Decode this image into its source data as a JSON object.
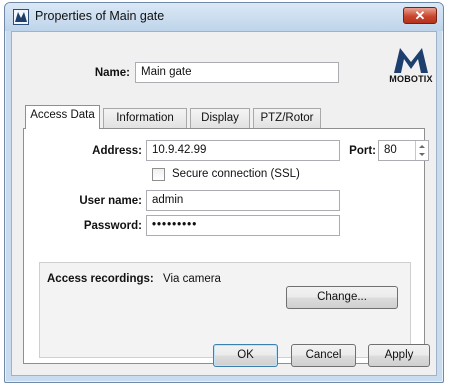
{
  "window": {
    "title": "Properties of Main gate",
    "close_label": "✕"
  },
  "header": {
    "name_label": "Name:",
    "name_value": "Main gate",
    "logo_text": "MOBOTIX"
  },
  "tabs": [
    {
      "label": "Access Data",
      "active": true
    },
    {
      "label": "Information",
      "active": false
    },
    {
      "label": "Display",
      "active": false
    },
    {
      "label": "PTZ/Rotor",
      "active": false
    }
  ],
  "access": {
    "address_label": "Address:",
    "address_value": "10.9.42.99",
    "port_label": "Port:",
    "port_value": "80",
    "ssl_label": "Secure connection (SSL)",
    "ssl_checked": false,
    "username_label": "User name:",
    "username_value": "admin",
    "password_label": "Password:",
    "password_value": "•••••••••"
  },
  "recordings": {
    "label": "Access recordings:",
    "value": "Via camera",
    "change_label": "Change..."
  },
  "footer": {
    "ok_label": "OK",
    "cancel_label": "Cancel",
    "apply_label": "Apply"
  },
  "colors": {
    "window_frame": "#c9dcef",
    "close_button": "#c9462f",
    "default_button_border": "#3c7fb1"
  }
}
